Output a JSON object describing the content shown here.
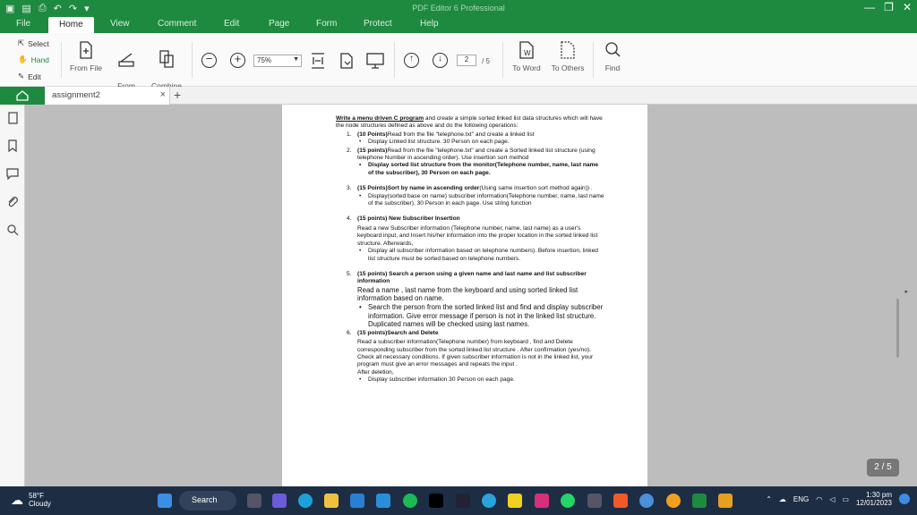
{
  "window": {
    "title": "PDF Editor 6 Professional"
  },
  "menu": {
    "tabs": [
      "File",
      "Home",
      "View",
      "Comment",
      "Edit",
      "Page",
      "Form",
      "Protect",
      "Help"
    ],
    "active": "Home"
  },
  "ribbon": {
    "select": "Select",
    "hand": "Hand",
    "edit": "Edit",
    "from_file": "From File",
    "from_scanner": "From\nScanner",
    "combine_files": "Combine\nFiles",
    "zoom": "75%",
    "page_current": "2",
    "page_total": "/ 5",
    "to_word": "To Word",
    "to_others": "To Others",
    "find": "Find"
  },
  "tabs": {
    "doc_name": "assignment2",
    "close": "×",
    "add": "+"
  },
  "document": {
    "intro_bold": "Write a menu driven C program",
    "intro_rest": " and create a simple sorted linked list data structures which will have the node structures defined as above and do the following operations:",
    "items": [
      {
        "n": "1.",
        "bold": "(10 Points)",
        "text": "Read from the file \"telephone.txt\" and create a linked list"
      },
      {
        "n": "2.",
        "bold": "(15 points)",
        "text": "Read from the file \"telephone.txt\" and create a Sorted linked list structure (using telephone Number in ascending order). Use insertion sort method"
      },
      {
        "n": "3.",
        "bold": "(15 Points)Sort by name in ascending order",
        "text": "(Using same insertion sort method again)) ."
      },
      {
        "n": "4.",
        "bold": "(15 points) New Subscriber Insertion",
        "text": ""
      },
      {
        "n": "5.",
        "bold": "(15 points) Search a person using a given name and last name and list subscriber information",
        "text": ""
      },
      {
        "n": "6.",
        "bold": "(15 points)Search and Delete",
        "text": ""
      }
    ],
    "b1": "Display Linked list structure. 30 Person on each page.",
    "b2": "Display sorted list structure from the monitor(Telephone number, name, last name of the subscriber), 30 Person on each page.",
    "b3": "Display(sorted base on name) subscriber information(Telephone number, name, last name of the subscriber), 30 Person in each page. Use string function",
    "p4": "Read a new Subscriber information (Telephone number, name, last name) as a user's keyboard input, and Insert his/her information into the proper location in the sorted linked list structure. Afterwards,",
    "b4": "Display all subscriber information based on telephone numbers). Before insertion, linked list structure must be sorted based on telephone numbers.",
    "p5": "Read a name , last name from the keyboard and using sorted linked list information based on name.",
    "b5": "Search the person from the sorted linked list and find and display subscriber information. Give error message if person is not in the linked list structure. Duplicated names will be checked using last names.",
    "p6": "Read a subscriber information(Telephone number) from keyboard , find and Delete corresponding subscriber from the sorted linked list structure . After confirmation (yes/no). Check all necessary conditions. If given subscriber information is not in the linked list, your program must give an error messages and repeats the input .",
    "p6b": "After deletion,",
    "b6": "Display subscriber information 30 Person on each page."
  },
  "page_badge": "2 / 5",
  "taskbar": {
    "temp": "58°F",
    "weather": "Cloudy",
    "search": "Search",
    "lang": "ENG",
    "time": "1:30 pm",
    "date": "12/01/2023"
  }
}
